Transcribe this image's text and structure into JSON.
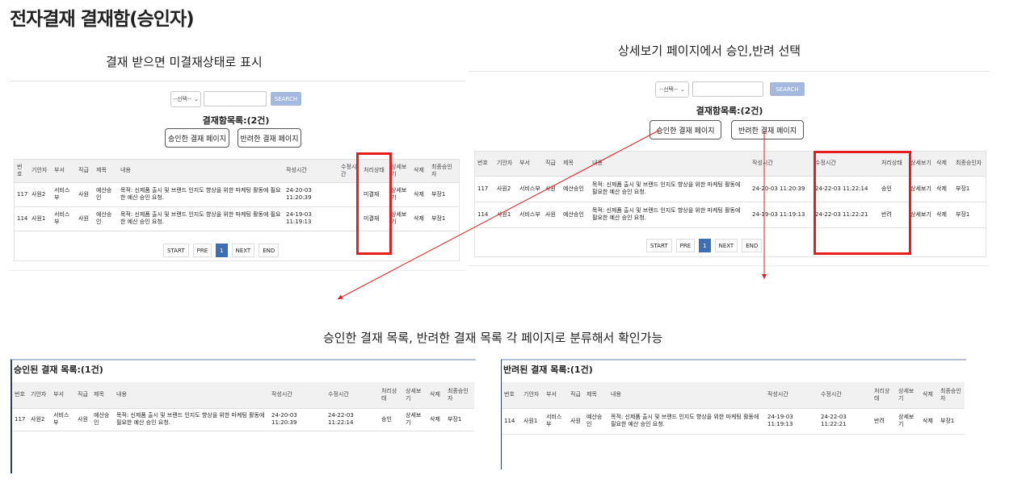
{
  "page_title": "전자결재 결재함(승인자)",
  "captions": {
    "left": "결재 받으면 미결재상태로 표시",
    "right": "상세보기 페이지에서 승인,반려 선택",
    "bottom": "승인한 결재 목록, 반려한 결재 목록 각 페이지로 분류해서 확인가능"
  },
  "colors": {
    "highlight": "#e51d1d",
    "search_button": "#a4b9dd",
    "active_page": "#3c6fb4"
  },
  "search": {
    "select_label": "--선택--",
    "button": "SEARCH"
  },
  "list_title": "결재함목록:(2건)",
  "buttons": {
    "approved_page": "승인한 결재 페이지",
    "rejected_page": "반려한 결재 페이지"
  },
  "columns": {
    "no": "번호",
    "drafter": "기안자",
    "dept": "부서",
    "rank": "직급",
    "title": "제목",
    "content": "내용",
    "created": "작성시간",
    "modified": "수정시간",
    "status": "처리상태",
    "detail": "상세보기",
    "delete": "삭제",
    "final_approver": "최종승인자"
  },
  "pager": {
    "start": "START",
    "prev": "PRE",
    "current": "1",
    "next": "NEXT",
    "end": "END"
  },
  "left_table": {
    "rows": [
      {
        "no": "117",
        "drafter": "사원2",
        "dept": "서비스부",
        "rank": "사원",
        "title": "예산승인",
        "content": "목적: 신제품 출시 및 브랜드 인지도 향상을 위한 마케팅 활동에 필요한 예산 승인 요청.",
        "created": "24-20-03 11:20:39",
        "modified": "",
        "status": "미결재",
        "detail": "상세보기",
        "delete": "삭제",
        "final_approver": "부장1"
      },
      {
        "no": "114",
        "drafter": "사원1",
        "dept": "서비스부",
        "rank": "사원",
        "title": "예산승인",
        "content": "목적: 신제품 출시 및 브랜드 인지도 향상을 위한 마케팅 활동에 필요한 예산 승인 요청.",
        "created": "24-19-03 11:19:13",
        "modified": "",
        "status": "미결재",
        "detail": "상세보기",
        "delete": "삭제",
        "final_approver": "부장1"
      }
    ]
  },
  "right_table": {
    "rows": [
      {
        "no": "117",
        "drafter": "사원2",
        "dept": "서비스부",
        "rank": "사원",
        "title": "예산승인",
        "content": "목적: 신제품 출시 및 브랜드 인지도 향상을 위한 마케팅 활동에 필요한 예산 승인 요청.",
        "created": "24-20-03 11:20:39",
        "modified": "24-22-03 11:22:14",
        "status": "승인",
        "detail": "상세보기",
        "delete": "삭제",
        "final_approver": "부장1"
      },
      {
        "no": "114",
        "drafter": "사원1",
        "dept": "서비스부",
        "rank": "사원",
        "title": "예산승인",
        "content": "목적: 신제품 출시 및 브랜드 인지도 향상을 위한 마케팅 활동에 필요한 예산 승인 요청.",
        "created": "24-19-03 11:19:13",
        "modified": "24-22-03 11:22:21",
        "status": "반려",
        "detail": "상세보기",
        "delete": "삭제",
        "final_approver": "부장1"
      }
    ]
  },
  "approved_list": {
    "title": "승인된 결재 목록:(1건)",
    "rows": [
      {
        "no": "117",
        "drafter": "사원2",
        "dept": "서비스부",
        "rank": "사원",
        "title": "예산승인",
        "content": "목적: 신제품 출시 및 브랜드 인지도 향상을 위한 마케팅 활동에 필요한 예산 승인 요청.",
        "created": "24-20-03 11:20:39",
        "modified": "24-22-03 11:22:14",
        "status": "승인",
        "detail": "상세보기",
        "delete": "삭제",
        "final_approver": "부장1"
      }
    ]
  },
  "rejected_list": {
    "title": "반려된 결재 목록:(1건)",
    "rows": [
      {
        "no": "114",
        "drafter": "사원1",
        "dept": "서비스부",
        "rank": "사원",
        "title": "예산승인",
        "content": "목적: 신제품 출시 및 브랜드 인지도 향상을 위한 마케팅 활동에 필요한 예산 승인 요청.",
        "created": "24-19-03 11:19:13",
        "modified": "24-22-03 11:22:21",
        "status": "반려",
        "detail": "상세보기",
        "delete": "삭제",
        "final_approver": "부장1"
      }
    ]
  }
}
